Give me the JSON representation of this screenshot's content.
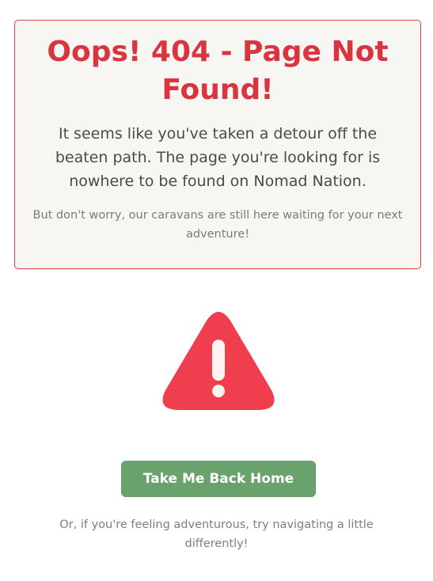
{
  "error_card": {
    "title": "Oops! 404 - Page Not Found!",
    "message": "It seems like you've taken a detour off the beaten path. The page you're looking for is nowhere to be found on Nomad Nation.",
    "reassurance": "But don't worry, our caravans are still here waiting for your next adventure!"
  },
  "icon": {
    "name": "warning-triangle-icon",
    "color": "#ef3f4f"
  },
  "actions": {
    "home_label": "Take Me Back Home"
  },
  "footer": {
    "note": "Or, if you're feeling adventurous, try navigating a little differently!"
  },
  "colors": {
    "accent_red": "#d9343f",
    "button_green": "#6aa26e",
    "card_background": "#f8f6f3"
  }
}
